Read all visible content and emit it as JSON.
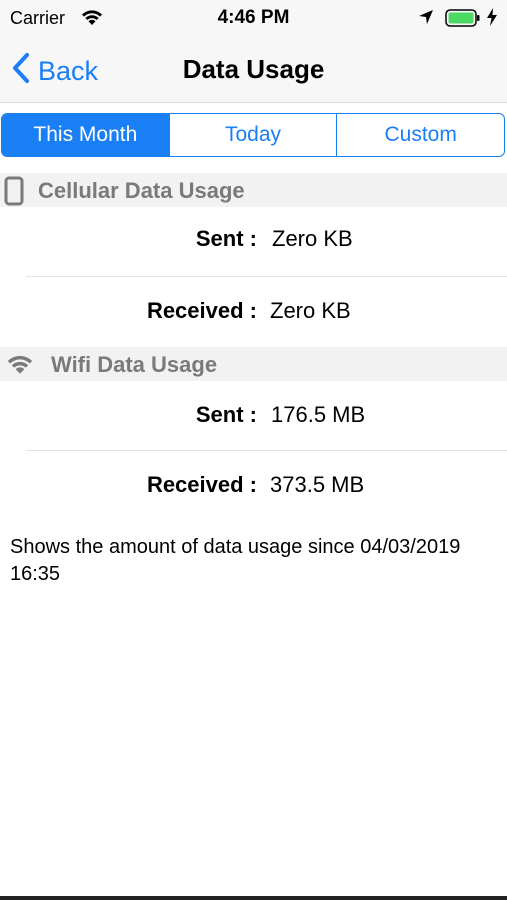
{
  "status_bar": {
    "carrier": "Carrier",
    "time": "4:46 PM",
    "battery_color": "#4cd964"
  },
  "nav": {
    "back_label": "Back",
    "title": "Data Usage"
  },
  "segments": [
    "This Month",
    "Today",
    "Custom"
  ],
  "selected_segment": "This Month",
  "cellular": {
    "title": "Cellular Data Usage",
    "sent_label": "Sent :",
    "sent_value": "Zero KB",
    "received_label": "Received :",
    "received_value": "Zero KB"
  },
  "wifi": {
    "title": "Wifi Data Usage",
    "sent_label": "Sent :",
    "sent_value": "176.5 MB",
    "received_label": "Received :",
    "received_value": "373.5 MB"
  },
  "footer_note": "Shows the amount of data usage since 04/03/2019 16:35",
  "accent_color": "#1a7ef5"
}
